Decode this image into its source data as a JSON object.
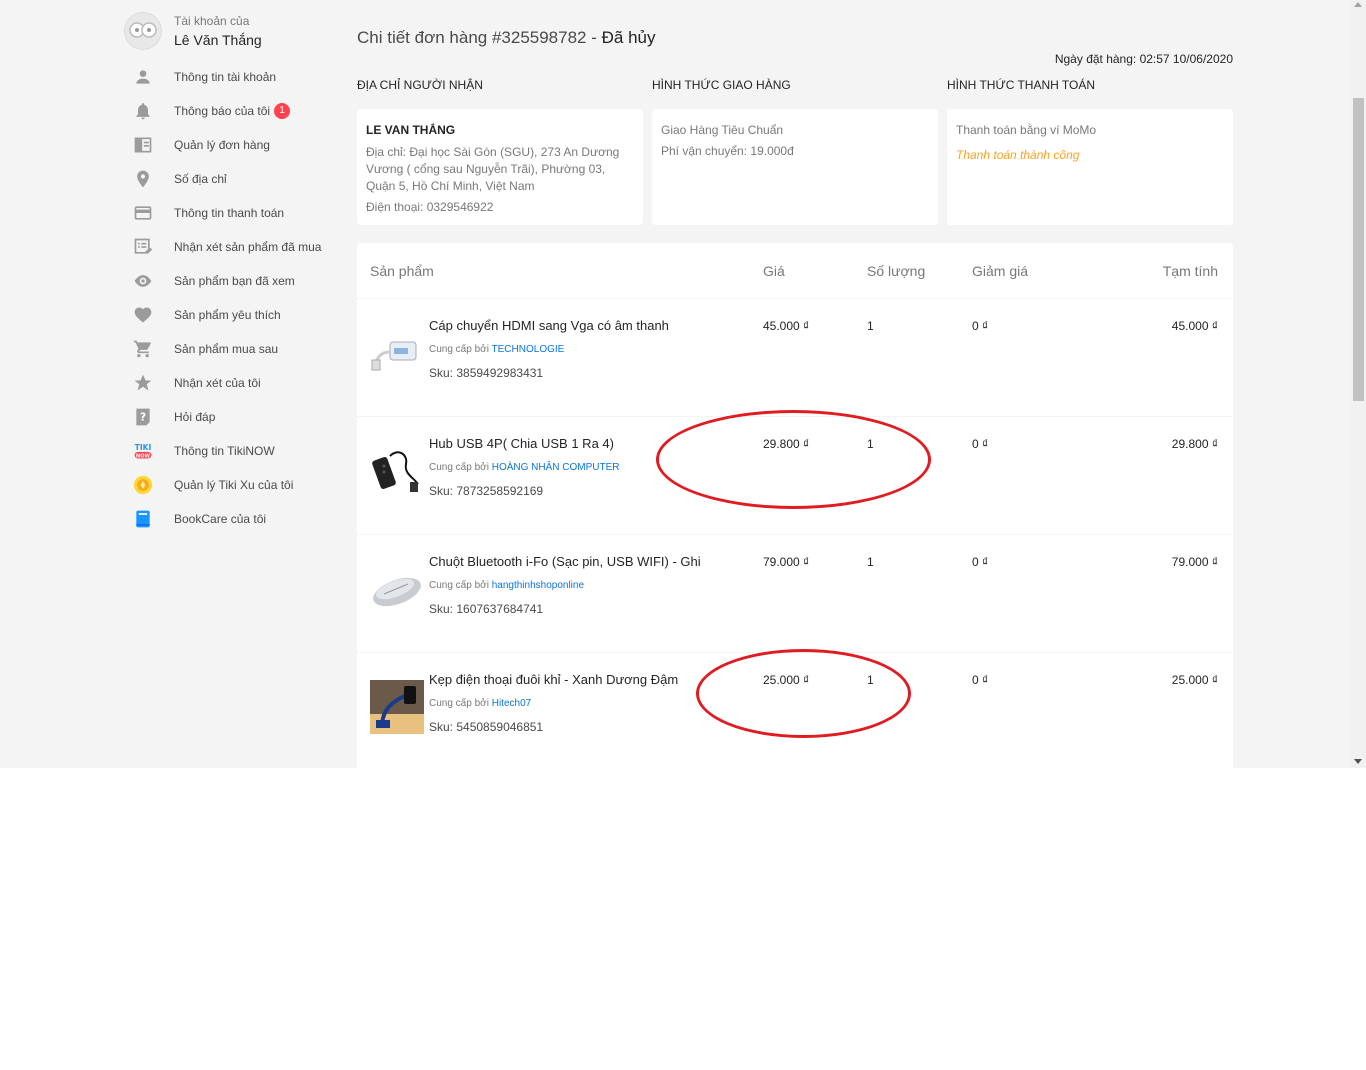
{
  "account": {
    "label": "Tài khoản của",
    "name": "Lê Văn Thắng"
  },
  "menu": [
    {
      "icon": "user-icon",
      "label": "Thông tin tài khoản"
    },
    {
      "icon": "bell-icon",
      "label": "Thông báo của tôi",
      "badge": "1"
    },
    {
      "icon": "order-icon",
      "label": "Quản lý đơn hàng"
    },
    {
      "icon": "location-icon",
      "label": "Số địa chỉ"
    },
    {
      "icon": "credit-card-icon",
      "label": "Thông tin thanh toán"
    },
    {
      "icon": "review-icon",
      "label": "Nhận xét sản phẩm đã mua"
    },
    {
      "icon": "eye-icon",
      "label": "Sản phẩm bạn đã xem"
    },
    {
      "icon": "heart-icon",
      "label": "Sản phẩm yêu thích"
    },
    {
      "icon": "cart-icon",
      "label": "Sản phẩm mua sau"
    },
    {
      "icon": "star-icon",
      "label": "Nhận xét của tôi"
    },
    {
      "icon": "question-icon",
      "label": "Hỏi đáp"
    },
    {
      "icon": "tikinow-icon",
      "label": "Thông tin TikiNOW"
    },
    {
      "icon": "coin-icon",
      "label": "Quản lý Tiki Xu của tôi"
    },
    {
      "icon": "book-icon",
      "label": "BookCare của tôi"
    }
  ],
  "order": {
    "title": "Chi tiết đơn hàng #325598782 - ",
    "status": "Đã hủy",
    "date": "Ngày đặt hàng: 02:57 10/06/2020"
  },
  "sections": {
    "recipient_title": "Địa chỉ người nhận",
    "shipping_title": "Hình thức giao hàng",
    "payment_title": "Hình thức thanh toán"
  },
  "recipient": {
    "name": "LE VAN THẮNG",
    "address": "Địa chỉ: Đại học Sài Gòn (SGU), 273 An Dương Vương ( cổng sau Nguyễn Trãi), Phường 03, Quận 5, Hồ Chí Minh, Việt Nam",
    "phone": "Điện thoại: 0329546922"
  },
  "shipping": {
    "method": "Giao Hàng Tiêu Chuẩn",
    "fee": "Phí vận chuyển: 19.000đ"
  },
  "payment": {
    "method": "Thanh toán bằng ví MoMo",
    "status": "Thanh toán thành công"
  },
  "table": {
    "headers": {
      "product": "Sản phẩm",
      "price": "Giá",
      "qty": "Số lượng",
      "discount": "Giảm giá",
      "subtotal": "Tạm tính"
    },
    "rows": [
      {
        "name": "Cáp chuyển HDMI sang Vga có âm thanh",
        "seller_prefix": "Cung cấp bởi ",
        "seller": "TECHNOLOGIE",
        "sku": "Sku: 3859492983431",
        "price": "45.000 ₫",
        "qty": "1",
        "discount": "0 ₫",
        "subtotal": "45.000 ₫"
      },
      {
        "name": "Hub USB 4P( Chia USB 1 Ra 4)",
        "seller_prefix": "Cung cấp bởi ",
        "seller": "HOÀNG NHÂN COMPUTER",
        "sku": "Sku: 7873258592169",
        "price": "29.800 ₫",
        "qty": "1",
        "discount": "0 ₫",
        "subtotal": "29.800 ₫"
      },
      {
        "name": "Chuột Bluetooth i-Fo (Sạc pin, USB WIFI) - Ghi",
        "seller_prefix": "Cung cấp bởi ",
        "seller": "hangthinhshoponline",
        "sku": "Sku: 1607637684741",
        "price": "79.000 ₫",
        "qty": "1",
        "discount": "0 ₫",
        "subtotal": "79.000 ₫"
      },
      {
        "name": "Kẹp điện thoại đuôi khỉ - Xanh Dương Đậm",
        "seller_prefix": "Cung cấp bởi ",
        "seller": "Hitech07",
        "sku": "Sku: 5450859046851",
        "price": "25.000 ₫",
        "qty": "1",
        "discount": "0 ₫",
        "subtotal": "25.000 ₫"
      }
    ]
  },
  "colors": {
    "accent_link": "#0b74e5",
    "badge": "#ff424e",
    "payment_success": "#fda223",
    "annotation": "#e01b22"
  }
}
